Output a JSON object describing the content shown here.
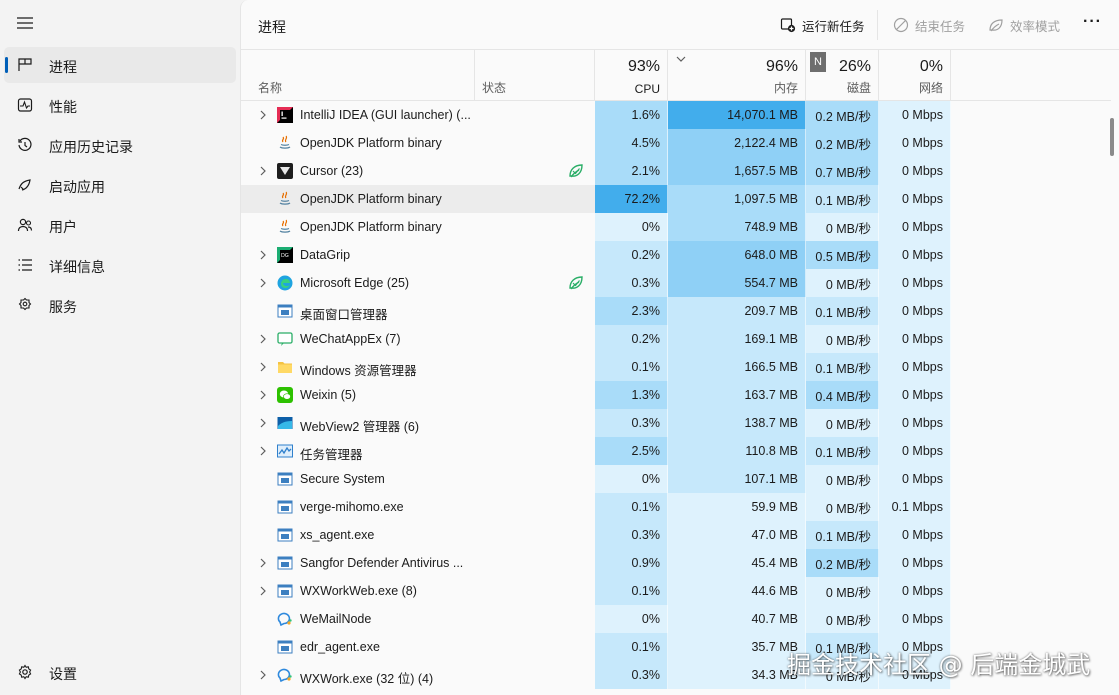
{
  "sidebar": {
    "items": [
      {
        "label": "进程",
        "icon": "processes-icon",
        "active": true
      },
      {
        "label": "性能",
        "icon": "performance-icon",
        "active": false
      },
      {
        "label": "应用历史记录",
        "icon": "history-icon",
        "active": false
      },
      {
        "label": "启动应用",
        "icon": "startup-icon",
        "active": false
      },
      {
        "label": "用户",
        "icon": "users-icon",
        "active": false
      },
      {
        "label": "详细信息",
        "icon": "details-icon",
        "active": false
      },
      {
        "label": "服务",
        "icon": "services-icon",
        "active": false
      }
    ],
    "settings_label": "设置"
  },
  "header": {
    "title": "进程",
    "run_task": "运行新任务",
    "end_task": "结束任务",
    "efficiency_mode": "效率模式"
  },
  "columns": {
    "name": "名称",
    "status": "状态",
    "cpu": {
      "pct": "93%",
      "label": "CPU"
    },
    "memory": {
      "pct": "96%",
      "label": "内存"
    },
    "disk": {
      "badge": "N",
      "pct": "26%",
      "label": "磁盘"
    },
    "network": {
      "pct": "0%",
      "label": "网络"
    }
  },
  "colors": {
    "heat_light": "#fff4c4",
    "level1": "#def2fd",
    "level2": "#c6e8fb",
    "level3": "#a9dcf9",
    "level4": "#8fd0f6",
    "level5": "#6cc1f2",
    "level6": "#42adec",
    "accent": "#005fb8"
  },
  "rows": [
    {
      "name": "IntelliJ IDEA (GUI launcher) (...",
      "expand": true,
      "icon": "intellij-icon",
      "cpu": "1.6%",
      "mem": "14,070.1 MB",
      "disk": "0.2 MB/秒",
      "net": "0 Mbps",
      "eco": false,
      "cpuL": 3,
      "memL": 6,
      "diskL": 3,
      "netL": 1
    },
    {
      "name": "OpenJDK Platform binary",
      "expand": false,
      "icon": "java-icon",
      "cpu": "4.5%",
      "mem": "2,122.4 MB",
      "disk": "0.2 MB/秒",
      "net": "0 Mbps",
      "eco": false,
      "cpuL": 3,
      "memL": 4,
      "diskL": 3,
      "netL": 1
    },
    {
      "name": "Cursor (23)",
      "expand": true,
      "icon": "cursor-icon",
      "cpu": "2.1%",
      "mem": "1,657.5 MB",
      "disk": "0.7 MB/秒",
      "net": "0 Mbps",
      "eco": true,
      "cpuL": 3,
      "memL": 4,
      "diskL": 3,
      "netL": 1
    },
    {
      "name": "OpenJDK Platform binary",
      "expand": false,
      "icon": "java-icon",
      "cpu": "72.2%",
      "mem": "1,097.5 MB",
      "disk": "0.1 MB/秒",
      "net": "0 Mbps",
      "eco": false,
      "cpuL": 6,
      "memL": 3,
      "diskL": 2,
      "netL": 1,
      "highlight": true
    },
    {
      "name": "OpenJDK Platform binary",
      "expand": false,
      "icon": "java-icon",
      "cpu": "0%",
      "mem": "748.9 MB",
      "disk": "0 MB/秒",
      "net": "0 Mbps",
      "eco": false,
      "cpuL": 1,
      "memL": 3,
      "diskL": 1,
      "netL": 1
    },
    {
      "name": "DataGrip",
      "expand": true,
      "icon": "datagrip-icon",
      "cpu": "0.2%",
      "mem": "648.0 MB",
      "disk": "0.5 MB/秒",
      "net": "0 Mbps",
      "eco": false,
      "cpuL": 2,
      "memL": 4,
      "diskL": 3,
      "netL": 1
    },
    {
      "name": "Microsoft Edge (25)",
      "expand": true,
      "icon": "edge-icon",
      "cpu": "0.3%",
      "mem": "554.7 MB",
      "disk": "0 MB/秒",
      "net": "0 Mbps",
      "eco": true,
      "cpuL": 2,
      "memL": 4,
      "diskL": 1,
      "netL": 1
    },
    {
      "name": "桌面窗口管理器",
      "expand": false,
      "icon": "window-icon",
      "cpu": "2.3%",
      "mem": "209.7 MB",
      "disk": "0.1 MB/秒",
      "net": "0 Mbps",
      "eco": false,
      "cpuL": 3,
      "memL": 2,
      "diskL": 2,
      "netL": 1
    },
    {
      "name": "WeChatAppEx (7)",
      "expand": true,
      "icon": "wechatapp-icon",
      "cpu": "0.2%",
      "mem": "169.1 MB",
      "disk": "0 MB/秒",
      "net": "0 Mbps",
      "eco": false,
      "cpuL": 2,
      "memL": 2,
      "diskL": 1,
      "netL": 1
    },
    {
      "name": "Windows 资源管理器",
      "expand": true,
      "icon": "folder-icon",
      "cpu": "0.1%",
      "mem": "166.5 MB",
      "disk": "0.1 MB/秒",
      "net": "0 Mbps",
      "eco": false,
      "cpuL": 2,
      "memL": 2,
      "diskL": 2,
      "netL": 1
    },
    {
      "name": "Weixin (5)",
      "expand": true,
      "icon": "weixin-icon",
      "cpu": "1.3%",
      "mem": "163.7 MB",
      "disk": "0.4 MB/秒",
      "net": "0 Mbps",
      "eco": false,
      "cpuL": 3,
      "memL": 2,
      "diskL": 3,
      "netL": 1
    },
    {
      "name": "WebView2 管理器 (6)",
      "expand": true,
      "icon": "webview-icon",
      "cpu": "0.3%",
      "mem": "138.7 MB",
      "disk": "0 MB/秒",
      "net": "0 Mbps",
      "eco": false,
      "cpuL": 2,
      "memL": 2,
      "diskL": 1,
      "netL": 1
    },
    {
      "name": "任务管理器",
      "expand": true,
      "icon": "taskmanager-icon",
      "cpu": "2.5%",
      "mem": "110.8 MB",
      "disk": "0.1 MB/秒",
      "net": "0 Mbps",
      "eco": false,
      "cpuL": 3,
      "memL": 2,
      "diskL": 2,
      "netL": 1
    },
    {
      "name": "Secure System",
      "expand": false,
      "icon": "window-icon",
      "cpu": "0%",
      "mem": "107.1 MB",
      "disk": "0 MB/秒",
      "net": "0 Mbps",
      "eco": false,
      "cpuL": 1,
      "memL": 2,
      "diskL": 1,
      "netL": 1
    },
    {
      "name": "verge-mihomo.exe",
      "expand": false,
      "icon": "window-icon",
      "cpu": "0.1%",
      "mem": "59.9 MB",
      "disk": "0 MB/秒",
      "net": "0.1 Mbps",
      "eco": false,
      "cpuL": 2,
      "memL": 1,
      "diskL": 1,
      "netL": 1
    },
    {
      "name": "xs_agent.exe",
      "expand": false,
      "icon": "window-icon",
      "cpu": "0.3%",
      "mem": "47.0 MB",
      "disk": "0.1 MB/秒",
      "net": "0 Mbps",
      "eco": false,
      "cpuL": 2,
      "memL": 1,
      "diskL": 2,
      "netL": 1
    },
    {
      "name": "Sangfor Defender Antivirus ...",
      "expand": true,
      "icon": "window-icon",
      "cpu": "0.9%",
      "mem": "45.4 MB",
      "disk": "0.2 MB/秒",
      "net": "0 Mbps",
      "eco": false,
      "cpuL": 2,
      "memL": 1,
      "diskL": 3,
      "netL": 1
    },
    {
      "name": "WXWorkWeb.exe (8)",
      "expand": true,
      "icon": "window-icon",
      "cpu": "0.1%",
      "mem": "44.6 MB",
      "disk": "0 MB/秒",
      "net": "0 Mbps",
      "eco": false,
      "cpuL": 2,
      "memL": 1,
      "diskL": 1,
      "netL": 1
    },
    {
      "name": "WeMailNode",
      "expand": false,
      "icon": "wxwork-icon",
      "cpu": "0%",
      "mem": "40.7 MB",
      "disk": "0 MB/秒",
      "net": "0 Mbps",
      "eco": false,
      "cpuL": 1,
      "memL": 1,
      "diskL": 1,
      "netL": 1
    },
    {
      "name": "edr_agent.exe",
      "expand": false,
      "icon": "window-icon",
      "cpu": "0.1%",
      "mem": "35.7 MB",
      "disk": "0.1 MB/秒",
      "net": "0 Mbps",
      "eco": false,
      "cpuL": 2,
      "memL": 1,
      "diskL": 2,
      "netL": 1
    },
    {
      "name": "WXWork.exe (32 位) (4)",
      "expand": true,
      "icon": "wxwork-icon",
      "cpu": "0.3%",
      "mem": "34.3 MB",
      "disk": "0 MB/秒",
      "net": "0 Mbps",
      "eco": false,
      "cpuL": 2,
      "memL": 1,
      "diskL": 1,
      "netL": 1
    }
  ],
  "watermark": "掘金技术社区 @ 后端金城武"
}
